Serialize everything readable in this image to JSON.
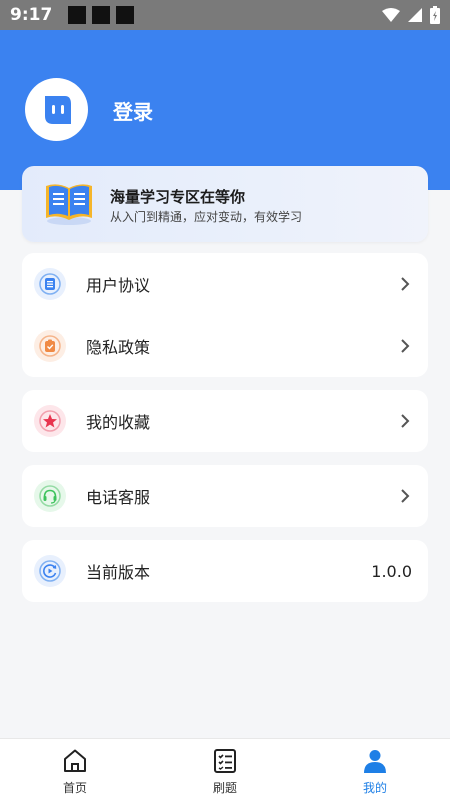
{
  "status_bar": {
    "time": "9:17"
  },
  "header": {
    "login_label": "登录"
  },
  "banner": {
    "title": "海量学习专区在等你",
    "subtitle": "从入门到精通，应对变动，有效学习"
  },
  "menu": {
    "user_agreement": "用户协议",
    "privacy_policy": "隐私政策",
    "favorites": "我的收藏",
    "customer_service": "电话客服",
    "current_version": "当前版本",
    "version_value": "1.0.0"
  },
  "tabbar": {
    "tabs": [
      {
        "label": "首页",
        "icon": "home-icon",
        "active": false
      },
      {
        "label": "刷题",
        "icon": "checklist-icon",
        "active": false
      },
      {
        "label": "我的",
        "icon": "person-icon",
        "active": true
      }
    ]
  },
  "colors": {
    "header_bg": "#3b82f0",
    "active_tab": "#1e7fe6"
  }
}
